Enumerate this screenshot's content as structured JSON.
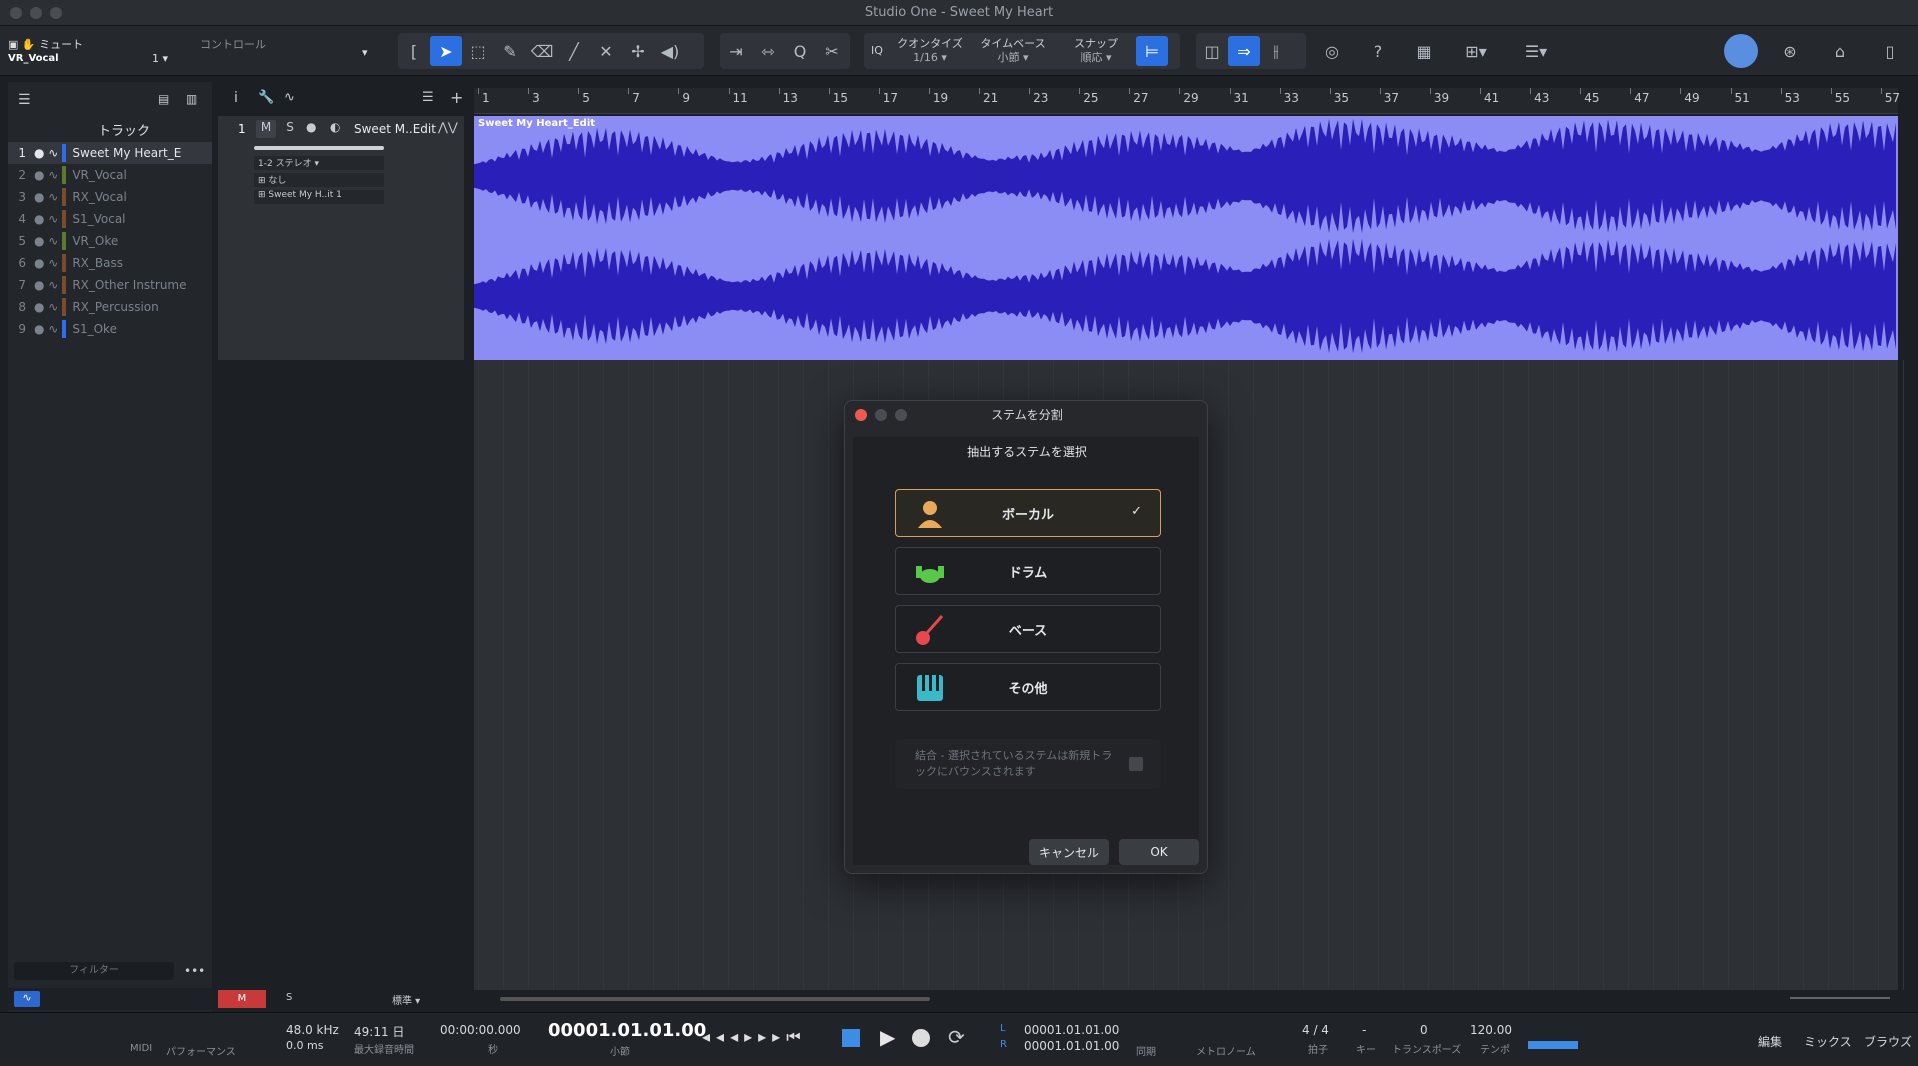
{
  "window": {
    "title": "Studio One - Sweet My Heart"
  },
  "toolbar": {
    "mute_label": "ミュート",
    "control_label": "コントロール",
    "track_name": "VR_Vocal",
    "channel": "1",
    "quantize": {
      "label": "クオンタイズ",
      "value": "1/16"
    },
    "timebase": {
      "label": "タイムベース",
      "value": "小節"
    },
    "snap": {
      "label": "スナップ",
      "value": "順応"
    },
    "iq": "IQ",
    "help": "?"
  },
  "tracks_header": "トラック",
  "tracks": [
    {
      "num": "1",
      "name": "Sweet My Heart_E",
      "color": "#2e6cf0"
    },
    {
      "num": "2",
      "name": "VR_Vocal",
      "color": "#5a7a2a"
    },
    {
      "num": "3",
      "name": "RX_Vocal",
      "color": "#7a4a2a"
    },
    {
      "num": "4",
      "name": "S1_Vocal",
      "color": "#7a4a2a"
    },
    {
      "num": "5",
      "name": "VR_Oke",
      "color": "#5a7a2a"
    },
    {
      "num": "6",
      "name": "RX_Bass",
      "color": "#7a4a2a"
    },
    {
      "num": "7",
      "name": "RX_Other Instrume",
      "color": "#7a4a2a"
    },
    {
      "num": "8",
      "name": "RX_Percussion",
      "color": "#7a4a2a"
    },
    {
      "num": "9",
      "name": "S1_Oke",
      "color": "#2e6cf0"
    }
  ],
  "filter_placeholder": "フィルター",
  "inspector": {
    "num": "1",
    "m": "M",
    "s": "S",
    "name": "Sweet M..Edit",
    "io": "1-2",
    "stereo": "ステレオ",
    "none": "なし",
    "clip": "Sweet My H..it 1"
  },
  "ruler_ticks": [
    "1",
    "3",
    "5",
    "7",
    "9",
    "11",
    "13",
    "15",
    "17",
    "19",
    "21",
    "23",
    "25",
    "27",
    "29",
    "31",
    "33",
    "35",
    "37",
    "39",
    "41",
    "43",
    "45",
    "47",
    "49",
    "51",
    "53",
    "55",
    "57"
  ],
  "clip_name": "Sweet My Heart_Edit",
  "dialog": {
    "title": "ステムを分割",
    "subtitle": "抽出するステムを選択",
    "stems": [
      {
        "label": "ボーカル",
        "icon": "vocal-icon",
        "selected": true,
        "check": "✓"
      },
      {
        "label": "ドラム",
        "icon": "drum-icon",
        "selected": false
      },
      {
        "label": "ベース",
        "icon": "bass-guitar-icon",
        "selected": false
      },
      {
        "label": "その他",
        "icon": "keyboard-icon",
        "selected": false
      }
    ],
    "combine_text": "結合 - 選択されているステムは新規トラックにバウンスされます",
    "cancel": "キャンセル",
    "ok": "OK"
  },
  "bottombar": {
    "m": "M",
    "s": "S",
    "standard": "標準"
  },
  "transport": {
    "midi": "MIDI",
    "perf": "パフォーマンス",
    "rate": "48.0 kHz",
    "latency": "0.0 ms",
    "rec_time": "49:11 日",
    "rec_label": "最大録音時間",
    "time": "00:00:00.000",
    "time_unit": "秒",
    "position": "00001.01.01.00",
    "pos_unit": "小節",
    "loop_l": "00001.01.01.00",
    "loop_r": "00001.01.01.00",
    "l": "L",
    "r": "R",
    "sync": "同期",
    "metronome": "メトロノーム",
    "signature": "4 / 4",
    "sig_label": "拍子",
    "key": "-",
    "key_label": "キー",
    "transpose": "0",
    "transpose_label": "トランスポーズ",
    "tempo": "120.00",
    "tempo_label": "テンポ"
  },
  "views": [
    "編集",
    "ミックス",
    "ブラウズ"
  ]
}
